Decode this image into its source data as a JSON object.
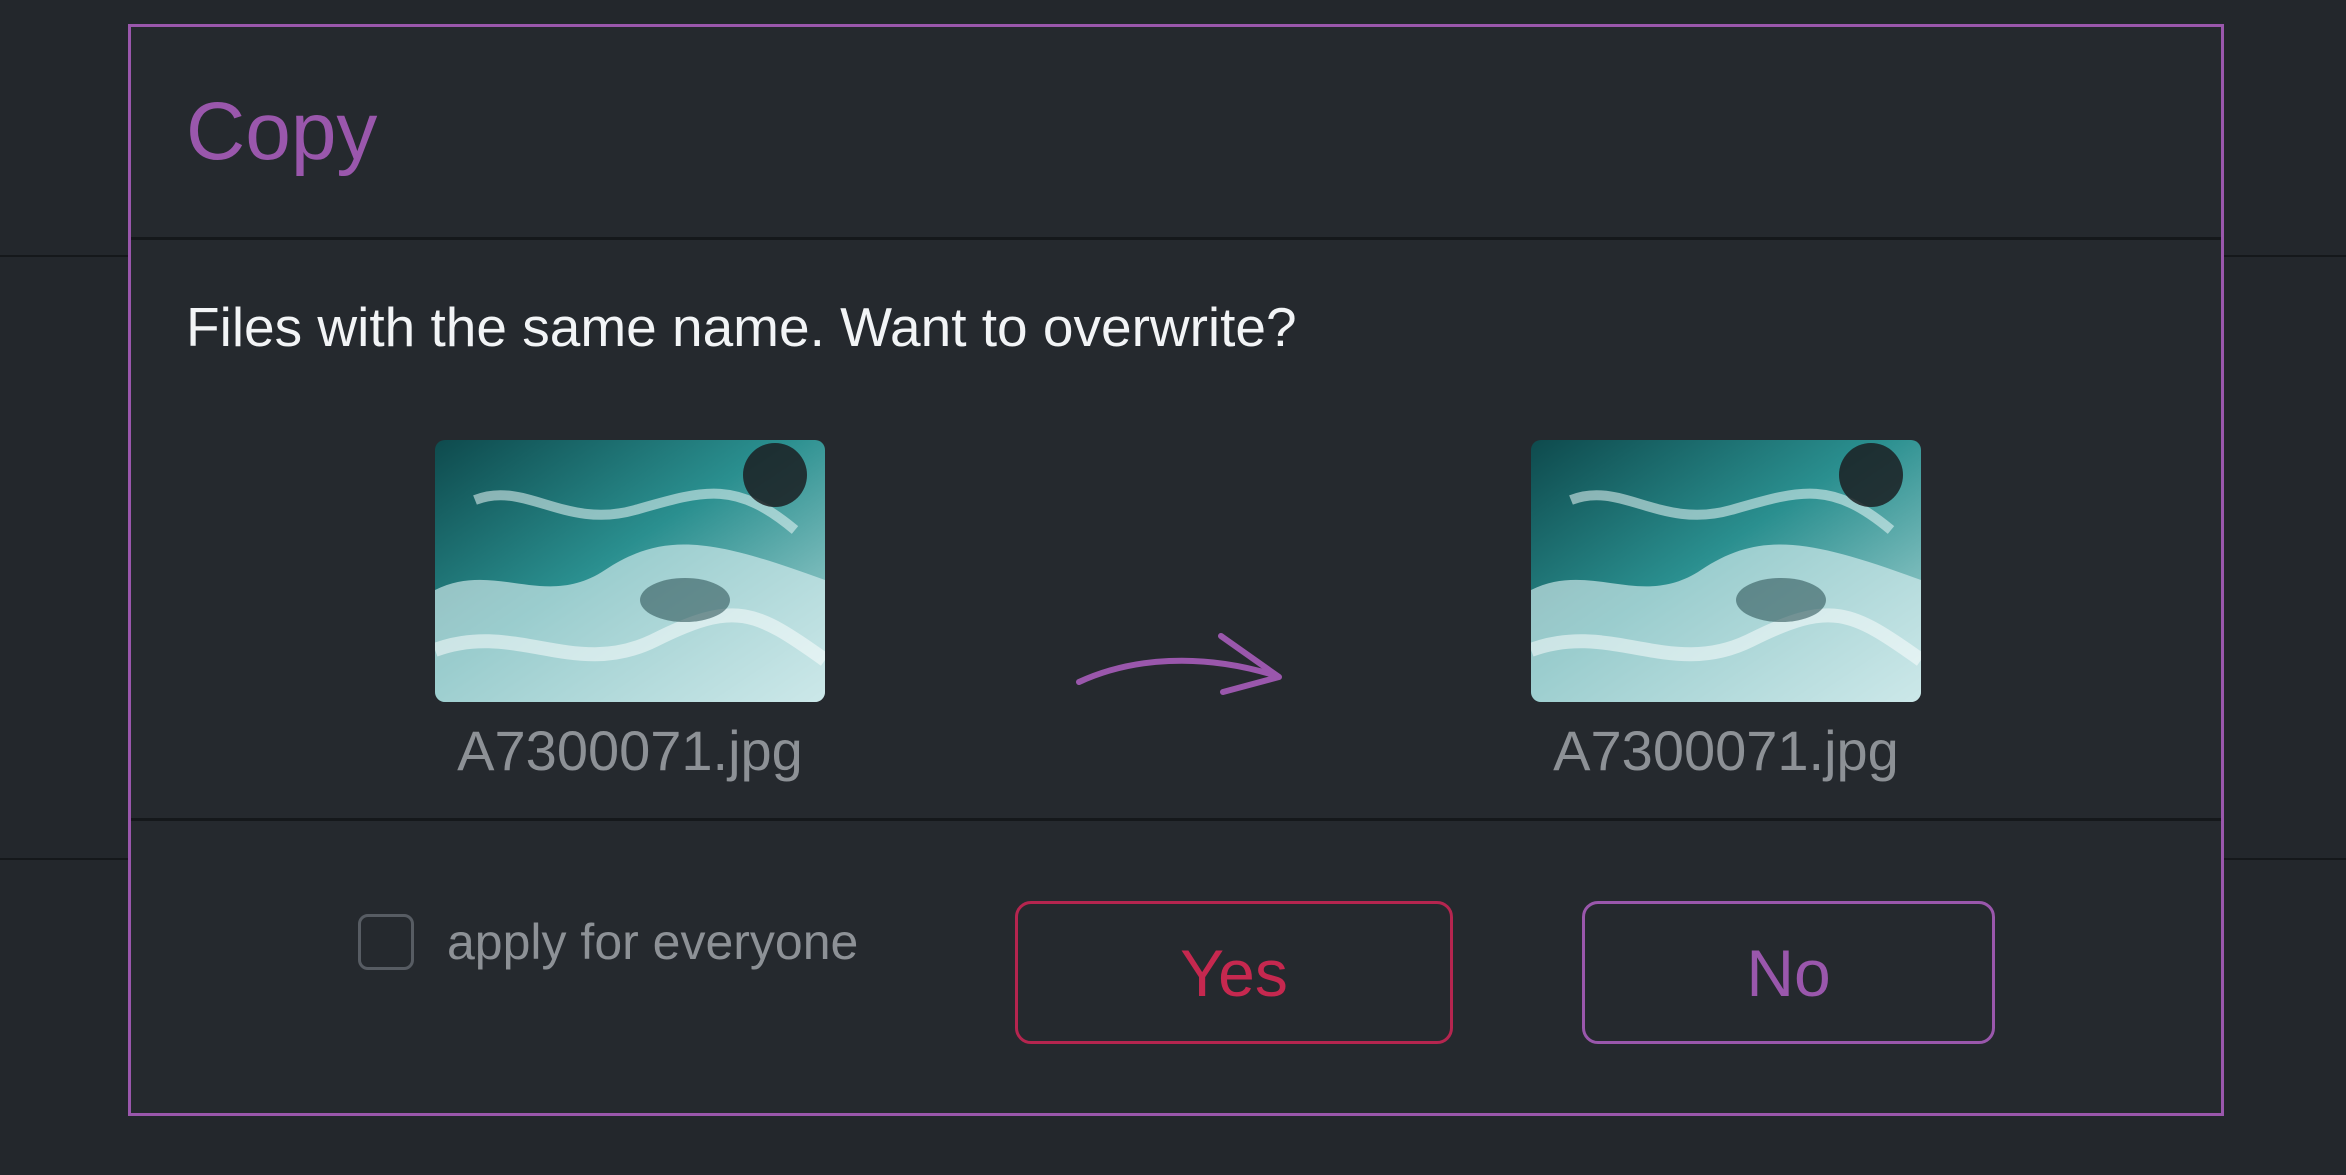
{
  "dialog": {
    "title": "Copy",
    "message": "Files with the same name. Want to overwrite?",
    "source_file": {
      "name": "A7300071.jpg"
    },
    "target_file": {
      "name": "A7300071.jpg"
    },
    "apply_label": "apply for everyone",
    "apply_checked": false,
    "yes_label": "Yes",
    "no_label": "No"
  },
  "colors": {
    "accent": "#9a57ac",
    "danger": "#c6284f",
    "background": "#23272c",
    "text": "#f2f4f6",
    "muted_text": "#8d9196"
  },
  "icons": {
    "arrow": "curved-arrow-right-icon",
    "checkbox": "checkbox-unchecked"
  }
}
